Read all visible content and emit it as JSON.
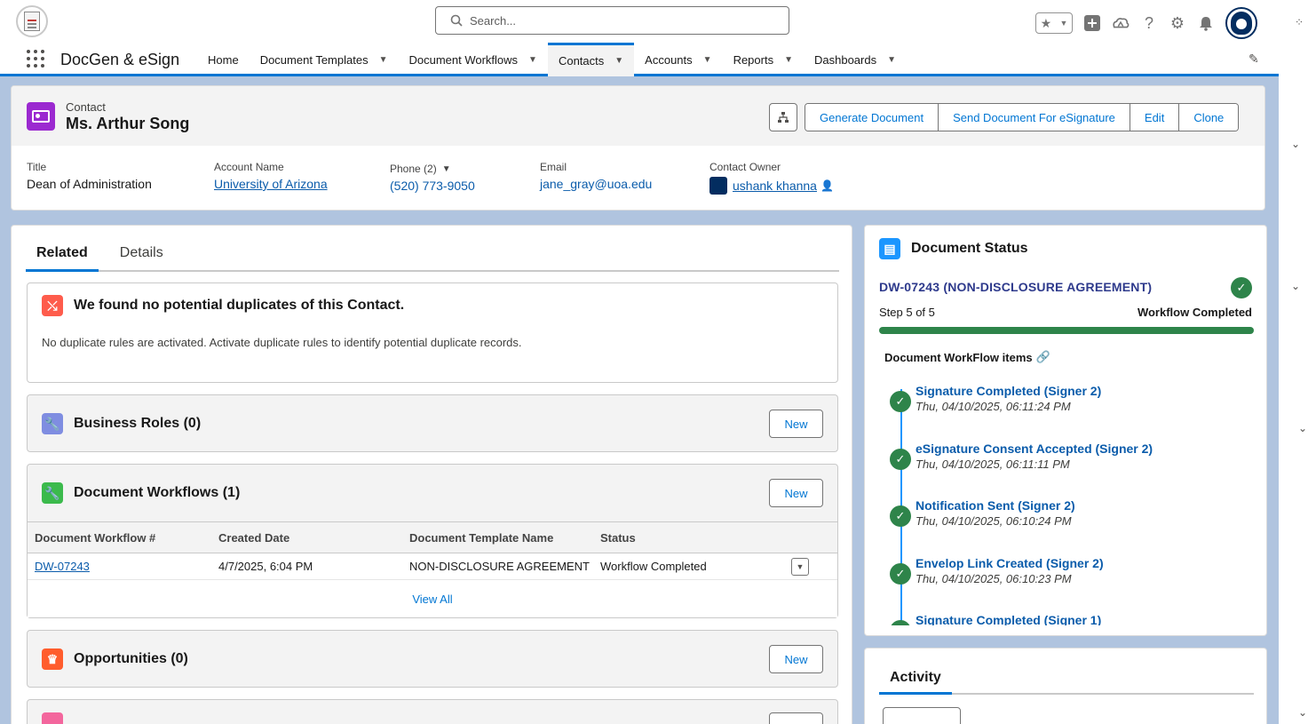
{
  "topbar": {
    "search_placeholder": "Search...",
    "logo_text": "eSign"
  },
  "nav": {
    "app_name": "DocGen & eSign",
    "items": [
      {
        "label": "Home",
        "has_menu": false,
        "active": false
      },
      {
        "label": "Document Templates",
        "has_menu": true,
        "active": false
      },
      {
        "label": "Document Workflows",
        "has_menu": true,
        "active": false
      },
      {
        "label": "Contacts",
        "has_menu": true,
        "active": true
      },
      {
        "label": "Accounts",
        "has_menu": true,
        "active": false
      },
      {
        "label": "Reports",
        "has_menu": true,
        "active": false
      },
      {
        "label": "Dashboards",
        "has_menu": true,
        "active": false
      }
    ]
  },
  "record": {
    "object_label": "Contact",
    "name": "Ms. Arthur Song",
    "buttons": [
      "Generate Document",
      "Send Document For eSignature",
      "Edit",
      "Clone"
    ],
    "fields": {
      "title_label": "Title",
      "title_value": "Dean of Administration",
      "account_label": "Account Name",
      "account_value": "University of Arizona",
      "phone_label": "Phone (2)",
      "phone_value": "(520) 773-9050",
      "email_label": "Email",
      "email_value": "jane_gray@uoa.edu",
      "owner_label": "Contact Owner",
      "owner_value": "ushank khanna"
    }
  },
  "tabs": {
    "related": "Related",
    "details": "Details"
  },
  "duplicates": {
    "title": "We found no potential duplicates of this Contact.",
    "message": "No duplicate rules are activated. Activate duplicate rules to identify potential duplicate records."
  },
  "business_roles": {
    "title": "Business Roles (0)",
    "new_label": "New"
  },
  "document_workflows": {
    "title": "Document Workflows (1)",
    "new_label": "New",
    "columns": [
      "Document Workflow #",
      "Created Date",
      "Document Template Name",
      "Status"
    ],
    "rows": [
      {
        "number": "DW-07243",
        "created": "4/7/2025, 6:04 PM",
        "template": "NON-DISCLOSURE AGREEMENT",
        "status": "Workflow Completed"
      }
    ],
    "view_all": "View All"
  },
  "opportunities": {
    "title": "Opportunities (0)",
    "new_label": "New"
  },
  "document_status": {
    "title": "Document Status",
    "workflow_link": "DW-07243 (NON-DISCLOSURE AGREEMENT)",
    "step": "Step 5 of 5",
    "state": "Workflow Completed",
    "progress": 1.0,
    "items_label": "Document WorkFlow items",
    "items": [
      {
        "title": "Signature Completed (Signer 2)",
        "date": "Thu, 04/10/2025, 06:11:24 PM"
      },
      {
        "title": "eSignature Consent Accepted (Signer 2)",
        "date": "Thu, 04/10/2025, 06:11:11 PM"
      },
      {
        "title": "Notification Sent (Signer 2)",
        "date": "Thu, 04/10/2025, 06:10:24 PM"
      },
      {
        "title": "Envelop Link Created (Signer 2)",
        "date": "Thu, 04/10/2025, 06:10:23 PM"
      },
      {
        "title": "Signature Completed (Signer 1)",
        "date": ""
      }
    ]
  },
  "activity": {
    "title": "Activity"
  },
  "colors": {
    "brand": "#0176d3",
    "success": "#2e844a",
    "contact_icon": "#9b29d0",
    "duplicate_icon": "#fe5c4c",
    "business_roles_icon": "#7f8de1",
    "workflow_icon": "#3bba4c",
    "opportunity_icon": "#ff5d2d"
  }
}
